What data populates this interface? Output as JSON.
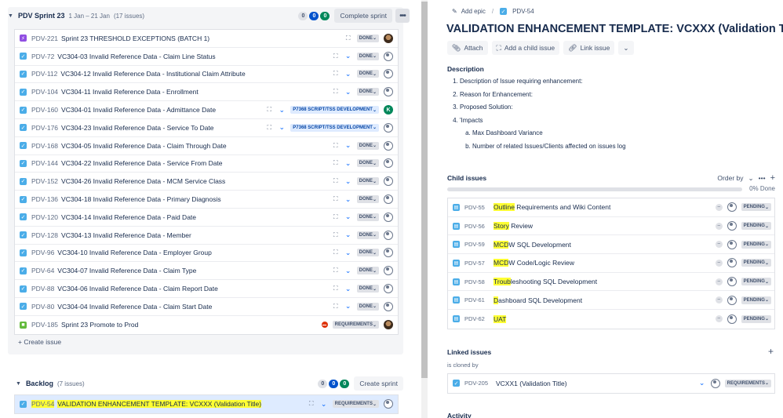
{
  "sprint": {
    "title": "PDV Sprint 23",
    "dates": "1 Jan – 21 Jan",
    "count": "(17 issues)",
    "pills": [
      "0",
      "0",
      "0"
    ],
    "complete_label": "Complete sprint",
    "more_label": "•••",
    "create_issue": "+ Create issue",
    "issues": [
      {
        "key": "PDV-221",
        "summary": "Sprint 23 THRESHOLD EXCEPTIONS (BATCH 1)",
        "type": "epic",
        "status": "DONE",
        "avatar": "photo",
        "child_icon": true,
        "priority": false
      },
      {
        "key": "PDV-72",
        "summary": "VC304-03 Invalid Reference Data - Claim Line Status",
        "type": "task",
        "status": "DONE",
        "avatar": "empty",
        "child_icon": true,
        "priority": true
      },
      {
        "key": "PDV-112",
        "summary": "VC304-12 Invalid Reference Data - Institutional Claim Attribute",
        "type": "task",
        "status": "DONE",
        "avatar": "empty",
        "child_icon": true,
        "priority": true
      },
      {
        "key": "PDV-104",
        "summary": "VC304-11 Invalid Reference Data - Enrollment",
        "type": "task",
        "status": "DONE",
        "avatar": "empty",
        "child_icon": true,
        "priority": true
      },
      {
        "key": "PDV-160",
        "summary": "VC304-01 Invalid Reference Data - Admittance Date",
        "type": "task",
        "status": "P7368 SCRIPT/TSS DEVELOPMENT",
        "avatar": "k",
        "child_icon": true,
        "priority": true
      },
      {
        "key": "PDV-176",
        "summary": "VC304-23 Invalid Reference Data - Service To Date",
        "type": "task",
        "status": "P7368 SCRIPT/TSS DEVELOPMENT",
        "avatar": "empty",
        "child_icon": true,
        "priority": true
      },
      {
        "key": "PDV-168",
        "summary": "VC304-05 Invalid Reference Data - Claim Through Date",
        "type": "task",
        "status": "DONE",
        "avatar": "empty",
        "child_icon": true,
        "priority": true
      },
      {
        "key": "PDV-144",
        "summary": "VC304-22 Invalid Reference Data - Service From Date",
        "type": "task",
        "status": "DONE",
        "avatar": "empty",
        "child_icon": true,
        "priority": true
      },
      {
        "key": "PDV-152",
        "summary": "VC304-26 Invalid Reference Data - MCM Service Class",
        "type": "task",
        "status": "DONE",
        "avatar": "empty",
        "child_icon": true,
        "priority": true
      },
      {
        "key": "PDV-136",
        "summary": "VC304-18 Invalid Reference Data - Primary Diagnosis",
        "type": "task",
        "status": "DONE",
        "avatar": "empty",
        "child_icon": true,
        "priority": true
      },
      {
        "key": "PDV-120",
        "summary": "VC304-14 Invalid Reference Data - Paid Date",
        "type": "task",
        "status": "DONE",
        "avatar": "empty",
        "child_icon": true,
        "priority": true
      },
      {
        "key": "PDV-128",
        "summary": "VC304-13 Invalid Reference Data - Member",
        "type": "task",
        "status": "DONE",
        "avatar": "empty",
        "child_icon": true,
        "priority": true
      },
      {
        "key": "PDV-96",
        "summary": "VC304-10 Invalid Reference Data - Employer Group",
        "type": "task",
        "status": "DONE",
        "avatar": "empty",
        "child_icon": true,
        "priority": true
      },
      {
        "key": "PDV-64",
        "summary": "VC304-07 Invalid Reference Data - Claim Type",
        "type": "task",
        "status": "DONE",
        "avatar": "empty",
        "child_icon": true,
        "priority": true
      },
      {
        "key": "PDV-88",
        "summary": "VC304-06 Invalid Reference Data - Claim Report Date",
        "type": "task",
        "status": "DONE",
        "avatar": "empty",
        "child_icon": true,
        "priority": true
      },
      {
        "key": "PDV-80",
        "summary": "VC304-04 Invalid Reference Data - Claim Start Date",
        "type": "task",
        "status": "DONE",
        "avatar": "empty",
        "child_icon": true,
        "priority": true
      },
      {
        "key": "PDV-185",
        "summary": "Sprint 23 Promote to Prod",
        "type": "story",
        "status": "REQUIREMENTS",
        "avatar": "photo",
        "child_icon": false,
        "priority": false,
        "blocker": true
      }
    ]
  },
  "backlog": {
    "title": "Backlog",
    "count": "(7 issues)",
    "pills": [
      "0",
      "0",
      "0"
    ],
    "create_label": "Create sprint",
    "issues": [
      {
        "key": "PDV-54",
        "summary": "VALIDATION ENHANCEMENT TEMPLATE: VCXXX (Validation Title)",
        "type": "task",
        "status": "REQUIREMENTS",
        "avatar": "empty",
        "child_icon": true,
        "priority": true
      }
    ]
  },
  "detail": {
    "add_epic": "Add epic",
    "crumb_sep": "/",
    "issue_key": "PDV-54",
    "title": "VALIDATION ENHANCEMENT TEMPLATE: VCXXX (Validation Title)",
    "actions": {
      "attach": "Attach",
      "add_child": "Add a child issue",
      "link": "Link issue",
      "more": "⌄"
    },
    "description_label": "Description",
    "description": {
      "items": [
        "Description of Issue requiring enhancement:",
        "Reason for Enhancement:",
        "Proposed Solution:",
        "'Impacts"
      ],
      "subitems": [
        "Max Dashboard Variance",
        "Number of related Issues/Clients affected on issues log"
      ]
    },
    "child_label": "Child issues",
    "order_by": "Order by",
    "order_more": "•••",
    "order_plus": "+",
    "progress_percent": 0,
    "progress_text": "0% Done",
    "children": [
      {
        "key": "PDV-55",
        "hl": "Outline",
        "rest": " Requirements and Wiki Content",
        "status": "PENDING"
      },
      {
        "key": "PDV-56",
        "hl": "Story",
        "rest": " Review",
        "status": "PENDING"
      },
      {
        "key": "PDV-59",
        "hl": "MCD",
        "rest": "W SQL Development",
        "status": "PENDING"
      },
      {
        "key": "PDV-57",
        "hl": "MCD",
        "rest": "W Code/Logic Review",
        "status": "PENDING"
      },
      {
        "key": "PDV-58",
        "hl": "Troub",
        "rest": "leshooting SQL Development",
        "status": "PENDING"
      },
      {
        "key": "PDV-61",
        "hl": "D",
        "rest": "ashboard SQL Development",
        "status": "PENDING"
      },
      {
        "key": "PDV-62",
        "hl": "UAT",
        "rest": "",
        "status": "PENDING"
      }
    ],
    "linked_label": "Linked issues",
    "linked_plus": "+",
    "cloned_label": "is cloned by",
    "linked": [
      {
        "key": "PDV-205",
        "summary": "VCXX1 (Validation Title)",
        "status": "REQUIREMENTS"
      }
    ],
    "activity_label": "Activity"
  },
  "colors": {
    "accent": "#0052cc",
    "highlight": "#ffff33",
    "selected_row": "#deebff"
  }
}
